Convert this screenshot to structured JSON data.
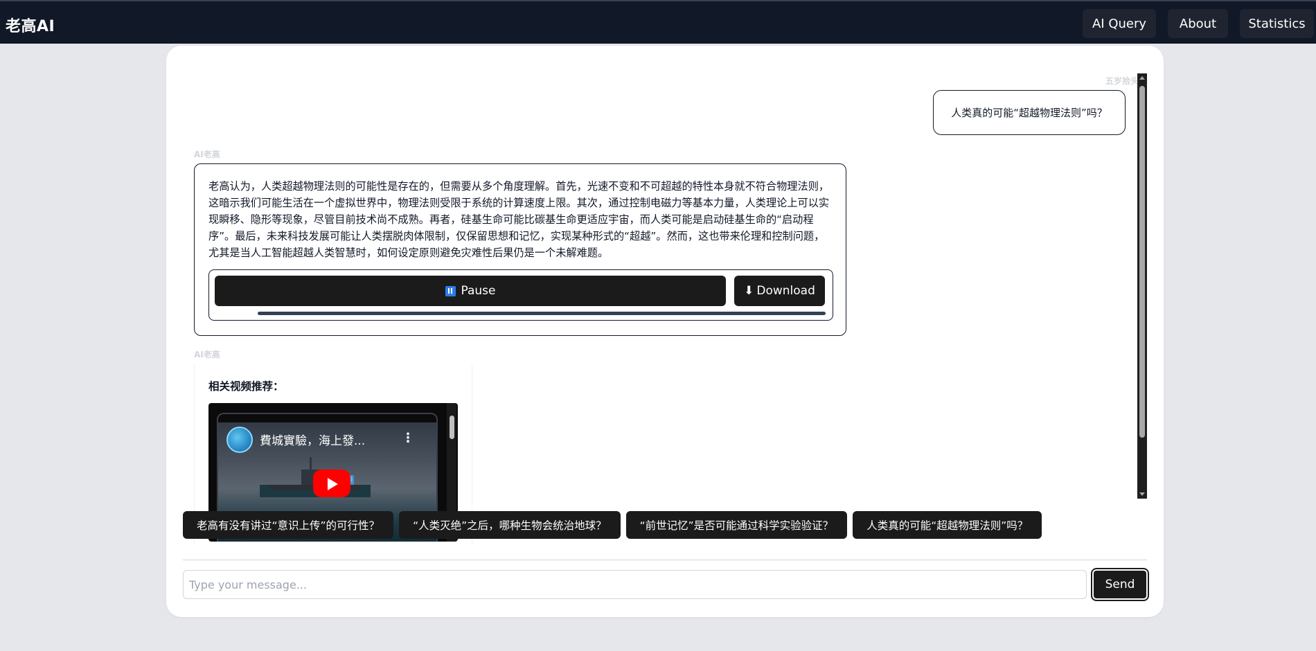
{
  "app": {
    "brand": "老高AI"
  },
  "nav": {
    "items": [
      {
        "label": "AI Query"
      },
      {
        "label": "About"
      },
      {
        "label": "Statistics"
      }
    ]
  },
  "chat": {
    "messages": [
      {
        "sender": "五岁拾头团",
        "role": "user",
        "text": "人类真的可能“超越物理法则”吗？"
      },
      {
        "sender": "AI老高",
        "role": "ai",
        "text": "老高认为，人类超越物理法则的可能性是存在的，但需要从多个角度理解。首先，光速不变和不可超越的特性本身就不符合物理法则，这暗示我们可能生活在一个虚拟世界中，物理法则受限于系统的计算速度上限。其次，通过控制电磁力等基本力量，人类理论上可以实现瞬移、隐形等现象，尽管目前技术尚不成熟。再者，硅基生命可能比碳基生命更适应宇宙，而人类可能是启动硅基生命的“启动程序”。最后，未来科技发展可能让人类摆脱肉体限制，仅保留思想和记忆，实现某种形式的“超越”。然而，这也带来伦理和控制问题，尤其是当人工智能超越人类智慧时，如何设定原则避免灾难性后果仍是一个未解难题。",
        "audio": {
          "pause_label": "Pause",
          "download_label": "Download",
          "pause_icon": "pause-icon",
          "download_icon": "download-arrow-icon",
          "progress": 1.0
        }
      },
      {
        "sender": "AI老高",
        "role": "ai",
        "video_heading": "相关视频推荐：",
        "video": {
          "title": "費城實驗，海上發...",
          "menu_glyph": "⋮"
        }
      }
    ]
  },
  "suggestions": [
    "老高有没有讲过“意识上传”的可行性？",
    "“人类灭绝”之后，哪种生物会统治地球？",
    "“前世记忆”是否可能通过科学实验验证？",
    "人类真的可能“超越物理法则”吗？"
  ],
  "composer": {
    "placeholder": "Type your message...",
    "value": "",
    "send_label": "Send"
  },
  "colors": {
    "navbar": "#111827",
    "button_dark": "#1b1b1b",
    "background": "#e5e7eb",
    "youtube_red": "#ff0000"
  }
}
